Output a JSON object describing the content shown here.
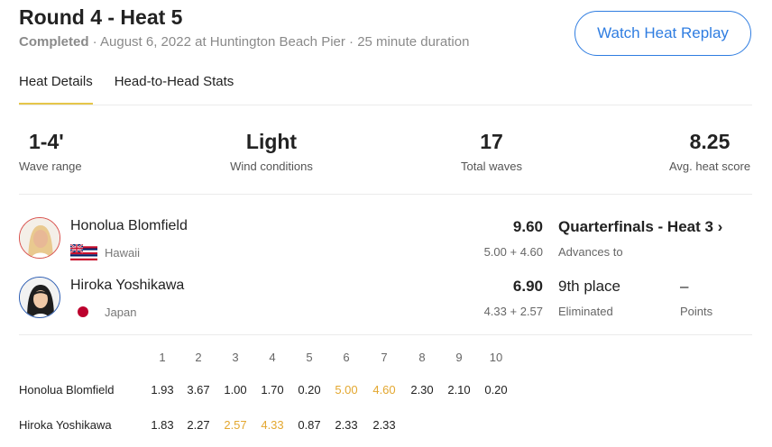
{
  "header": {
    "title": "Round 4 - Heat 5",
    "status": "Completed",
    "details": " · August 6, 2022 at Huntington Beach Pier · 25 minute duration",
    "replay_button": "Watch Heat Replay"
  },
  "tabs": [
    {
      "label": "Heat Details",
      "active": true
    },
    {
      "label": "Head-to-Head Stats",
      "active": false
    }
  ],
  "stats": [
    {
      "value": "1-4'",
      "label": "Wave range"
    },
    {
      "value": "Light",
      "label": "Wind conditions"
    },
    {
      "value": "17",
      "label": "Total waves"
    },
    {
      "value": "8.25",
      "label": "Avg. heat score"
    }
  ],
  "surfers": [
    {
      "name": "Honolua Blomfield",
      "country": "Hawaii",
      "flag_icon": "hawaii-flag-icon",
      "total": "9.60",
      "waves": "5.00 + 4.60",
      "result": "Quarterfinals - Heat 3 ›",
      "result_sub": "Advances to",
      "accent": "#d9534f"
    },
    {
      "name": "Hiroka Yoshikawa",
      "country": "Japan",
      "flag_icon": "japan-flag-icon",
      "total": "6.90",
      "waves": "4.33 + 2.57",
      "result": "9th place",
      "result_sub": "Eliminated",
      "points": "–",
      "points_sub": "Points",
      "accent": "#2f5fb3"
    }
  ],
  "wave_table": {
    "headers": [
      "1",
      "2",
      "3",
      "4",
      "5",
      "6",
      "7",
      "8",
      "9",
      "10"
    ],
    "rows": [
      {
        "name": "Honolua Blomfield",
        "scores": [
          "1.93",
          "3.67",
          "1.00",
          "1.70",
          "0.20",
          "5.00",
          "4.60",
          "2.30",
          "2.10",
          "0.20"
        ],
        "highlight": [
          5,
          6
        ]
      },
      {
        "name": "Hiroka Yoshikawa",
        "scores": [
          "1.83",
          "2.27",
          "2.57",
          "4.33",
          "0.87",
          "2.33",
          "2.33"
        ],
        "highlight": [
          2,
          3
        ]
      }
    ],
    "highlight_color": "#e3a72f"
  }
}
